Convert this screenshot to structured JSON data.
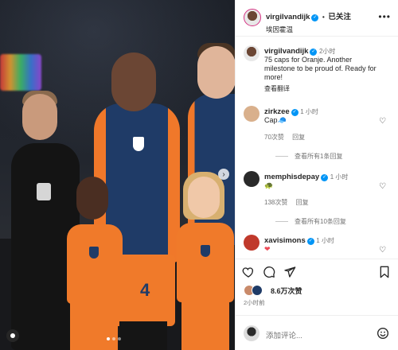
{
  "post": {
    "carousel": {
      "slide_count": 3,
      "active_slide": 1
    }
  },
  "header": {
    "username": "virgilvandijk",
    "separator": "•",
    "follow_status": "已关注",
    "subtitle": "埃因霍温",
    "more_label": "•••"
  },
  "caption": {
    "username": "virgilvandijk",
    "time": "2小时",
    "text": "75 caps for Oranje. Another milestone to be proud of. Ready for more!",
    "translate_label": "查看翻译"
  },
  "comments": [
    {
      "username": "zirkzee",
      "time": "1 小时",
      "text": "Cap🧢",
      "likes": "70次赞",
      "reply_label": "回复",
      "view_replies": "查看所有1条回复",
      "avatar_color": "#d9b08c"
    },
    {
      "username": "memphisdepay",
      "time": "1 小时",
      "text": "🐢",
      "likes": "138次赞",
      "reply_label": "回复",
      "view_replies": "查看所有10条回复",
      "avatar_color": "#2a2a2a"
    },
    {
      "username": "xavisimons",
      "time": "1 小时",
      "text": "❤",
      "avatar_color": "#c0392b"
    }
  ],
  "actions": {
    "like_count": "8.6万次赞",
    "time_ago": "2小时前"
  },
  "add_comment": {
    "placeholder": "添加评论..."
  },
  "colors": {
    "accent_blue": "#0095f6",
    "oranje": "#f07a2a",
    "navy": "#1f3b67",
    "heart_red": "#ed4956"
  },
  "icons": [
    "heart-icon",
    "comment-icon",
    "share-icon",
    "bookmark-icon",
    "emoji-icon",
    "verified-icon",
    "user-tag-icon",
    "next-arrow-icon"
  ]
}
